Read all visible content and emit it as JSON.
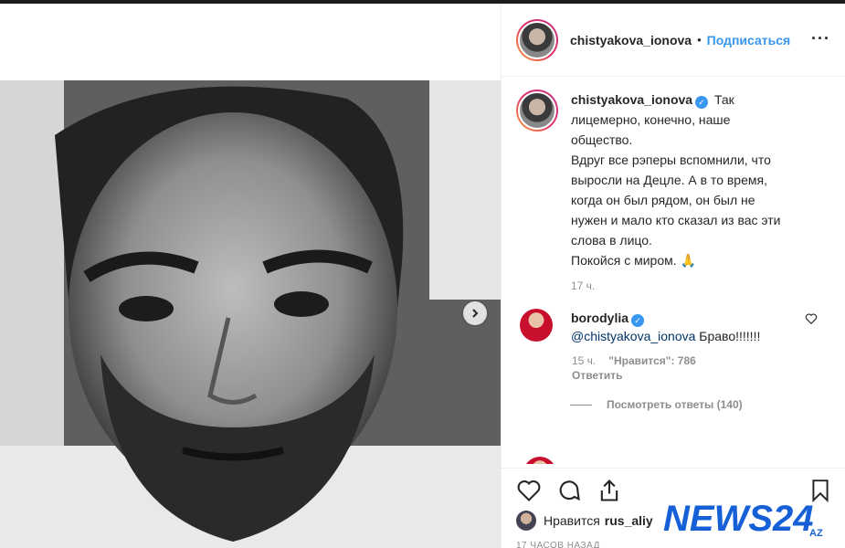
{
  "post": {
    "username": "chistyakova_ionova",
    "follow_label": "Подписаться",
    "separator": "•",
    "more_label": "···"
  },
  "caption": {
    "username": "chistyakova_ionova",
    "lines": [
      "Так",
      "лицемерно, конечно, наше",
      "общество.",
      "Вдруг все рэперы вспомнили, что",
      "выросли на Децле. А в то время,",
      "когда он был рядом, он был не",
      "нужен и мало кто сказал из вас эти",
      "слова в лицо.",
      "Покойся с миром. 🙏"
    ],
    "time": "17 ч."
  },
  "comment": {
    "username": "borodylia",
    "mention": "@chistyakova_ionova",
    "text": " Браво!!!!!!!",
    "time": "15 ч.",
    "likes_label": "\"Нравится\": 786",
    "reply_label": "Ответить",
    "view_replies": "Посмотреть ответы (140)"
  },
  "footer": {
    "likes_prefix": "Нравится",
    "liked_by": "rus_aliy",
    "time_ago": "17 ЧАСОВ НАЗАД"
  },
  "watermark": {
    "text": "NEWS24",
    "suffix": "AZ"
  },
  "colors": {
    "accent": "#3897f0",
    "text": "#262626",
    "muted": "#8e8e8e",
    "watermark_blue": "#1560d6"
  }
}
